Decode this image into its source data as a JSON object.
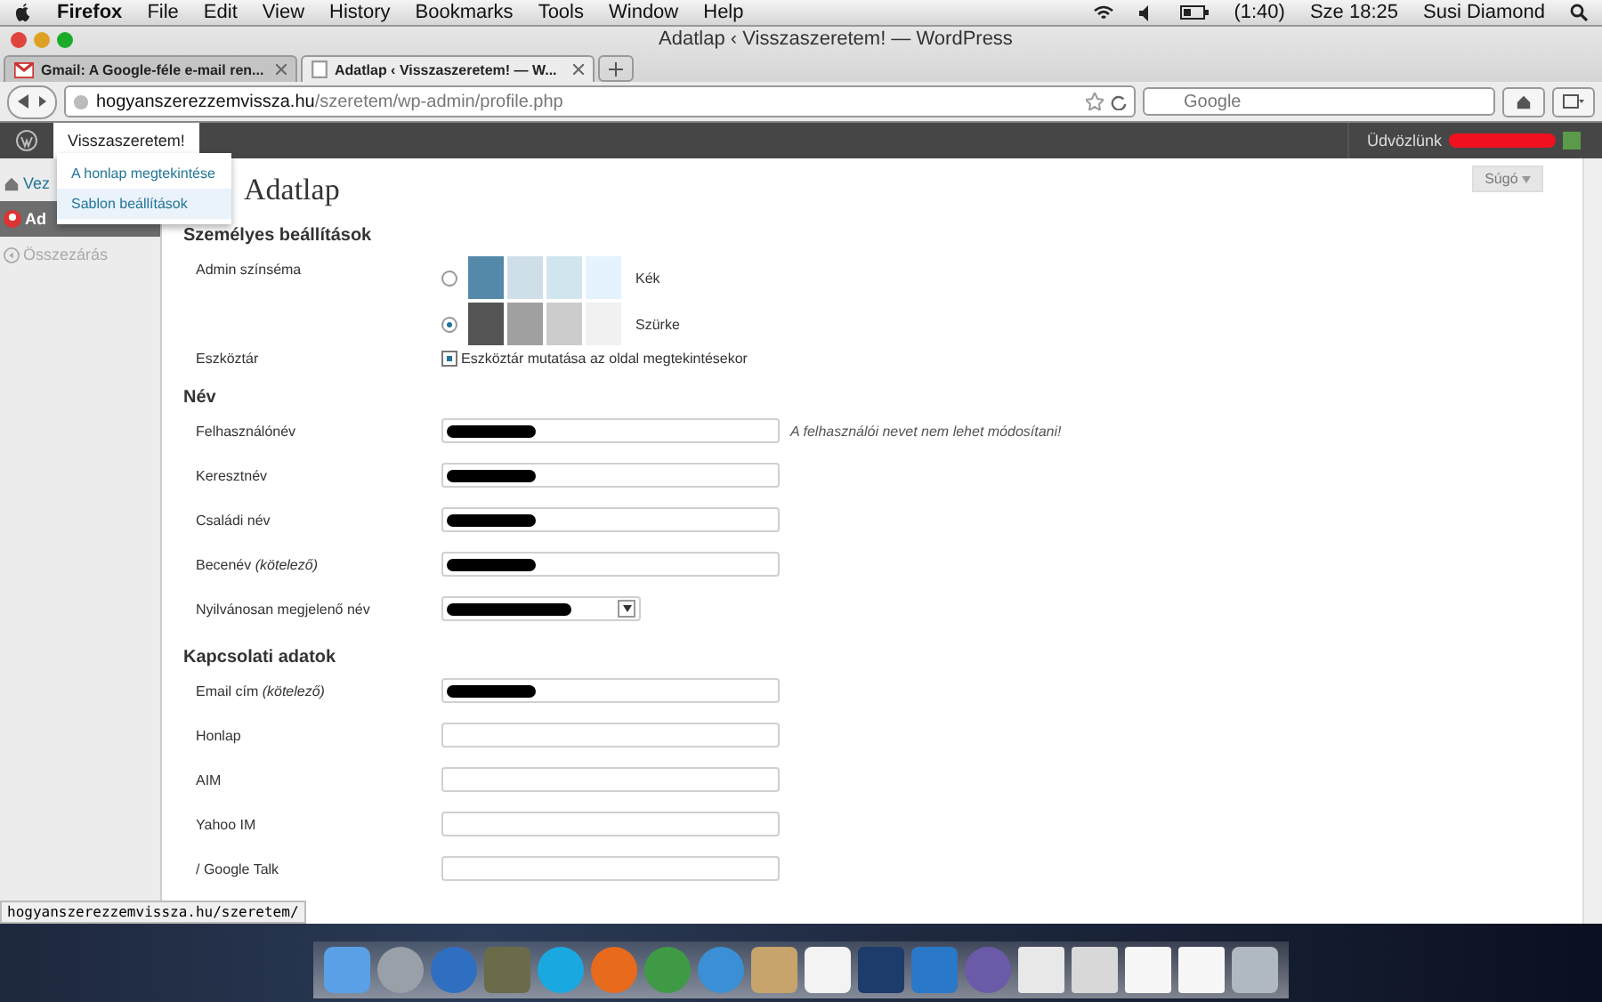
{
  "menubar": {
    "app": "Firefox",
    "menus": [
      "File",
      "Edit",
      "View",
      "History",
      "Bookmarks",
      "Tools",
      "Window",
      "Help"
    ],
    "battery": "(1:40)",
    "clock": "Sze 18:25",
    "user": "Susi Diamond"
  },
  "window": {
    "title": "Adatlap ‹ Visszaszeretem! — WordPress"
  },
  "tabs": [
    {
      "label": "Gmail: A Google-féle e-mail ren...",
      "selected": false,
      "kind": "gmail"
    },
    {
      "label": "Adatlap ‹ Visszaszeretem! — W...",
      "selected": true,
      "kind": "page"
    }
  ],
  "address_bar": {
    "domain": "hogyanszerezzemvissza.hu",
    "path": "/szeretem/wp-admin/profile.php"
  },
  "search": {
    "placeholder": "Google"
  },
  "admin_bar": {
    "site": "Visszaszeretem!",
    "greeting": "Üdvözlünk",
    "site_menu": [
      {
        "label": "A honlap megtekintése",
        "selected": false
      },
      {
        "label": "Sablon beállítások",
        "selected": true
      }
    ]
  },
  "sidebar": {
    "items": [
      {
        "label": "Vez",
        "selected": false,
        "kind": "home"
      },
      {
        "label": "Ad",
        "selected": true,
        "kind": "user"
      },
      {
        "label": "Összezárás",
        "selected": false,
        "kind": "collapse"
      }
    ]
  },
  "help_button": "Súgó",
  "page_title": "Adatlap",
  "sections": [
    {
      "title": "Személyes beállítások",
      "rows": [
        {
          "kind": "scheme",
          "label": "Admin színséma",
          "options": [
            {
              "label": "Kék",
              "selected": false,
              "swatches": [
                {
                  "color": "#5589aa"
                },
                {
                  "color": "#cfdfe9"
                },
                {
                  "color": "#d1e5ee"
                },
                {
                  "color": "#e5f3ff"
                }
              ]
            },
            {
              "label": "Szürke",
              "selected": true,
              "swatches": [
                {
                  "color": "#555555"
                },
                {
                  "color": "#a0a0a0"
                },
                {
                  "color": "#cccccc"
                },
                {
                  "color": "#f1f1f1"
                }
              ]
            }
          ]
        },
        {
          "kind": "checkbox",
          "label": "Eszköztár",
          "text": "Eszköztár mutatása az oldal megtekintésekor",
          "checked": true
        }
      ]
    },
    {
      "title": "Név",
      "rows": [
        {
          "kind": "text",
          "label": "Felhasználónév",
          "redacted": true,
          "note": "A felhasználói nevet nem lehet módosítani!"
        },
        {
          "kind": "text",
          "label": "Keresztnév",
          "redacted": true
        },
        {
          "kind": "text",
          "label": "Családi név",
          "redacted": true
        },
        {
          "kind": "text",
          "label": "Becenév *(kötelező)*",
          "redacted": true
        },
        {
          "kind": "select",
          "label": "Nyilvánosan megjelenő név",
          "redacted": true
        }
      ]
    },
    {
      "title": "Kapcsolati adatok",
      "rows": [
        {
          "kind": "text",
          "label": "Email cím *(kötelező)*",
          "redacted": true
        },
        {
          "kind": "text",
          "label": "Honlap",
          "redacted": false
        },
        {
          "kind": "text",
          "label": "AIM",
          "redacted": false
        },
        {
          "kind": "text",
          "label": "Yahoo IM",
          "redacted": false
        },
        {
          "kind": "text",
          "label": "/ Google Talk",
          "redacted": false
        }
      ]
    }
  ],
  "status_link": "hogyanszerezzemvissza.hu/szeretem/"
}
